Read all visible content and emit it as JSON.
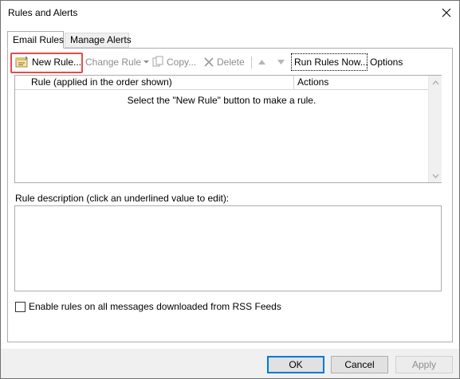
{
  "window": {
    "title": "Rules and Alerts"
  },
  "tabs": [
    {
      "label": "Email Rules",
      "active": true
    },
    {
      "label": "Manage Alerts",
      "active": false
    }
  ],
  "toolbar": {
    "new_rule": "New Rule...",
    "change_rule": "Change Rule",
    "copy": "Copy...",
    "delete": "Delete",
    "run_rules_now": "Run Rules Now...",
    "options": "Options"
  },
  "rules_table": {
    "columns": [
      "Rule (applied in the order shown)",
      "Actions"
    ],
    "empty_message": "Select the \"New Rule\" button to make a rule.",
    "rows": []
  },
  "rule_description": {
    "label": "Rule description (click an underlined value to edit):",
    "text": ""
  },
  "rss_option": {
    "label": "Enable rules on all messages downloaded from RSS Feeds",
    "checked": false
  },
  "buttons": {
    "ok": "OK",
    "cancel": "Cancel",
    "apply": "Apply"
  },
  "colors": {
    "highlight_border": "#e84a4a",
    "default_button_border": "#0078d7",
    "disabled_text": "#8d8d8d"
  }
}
